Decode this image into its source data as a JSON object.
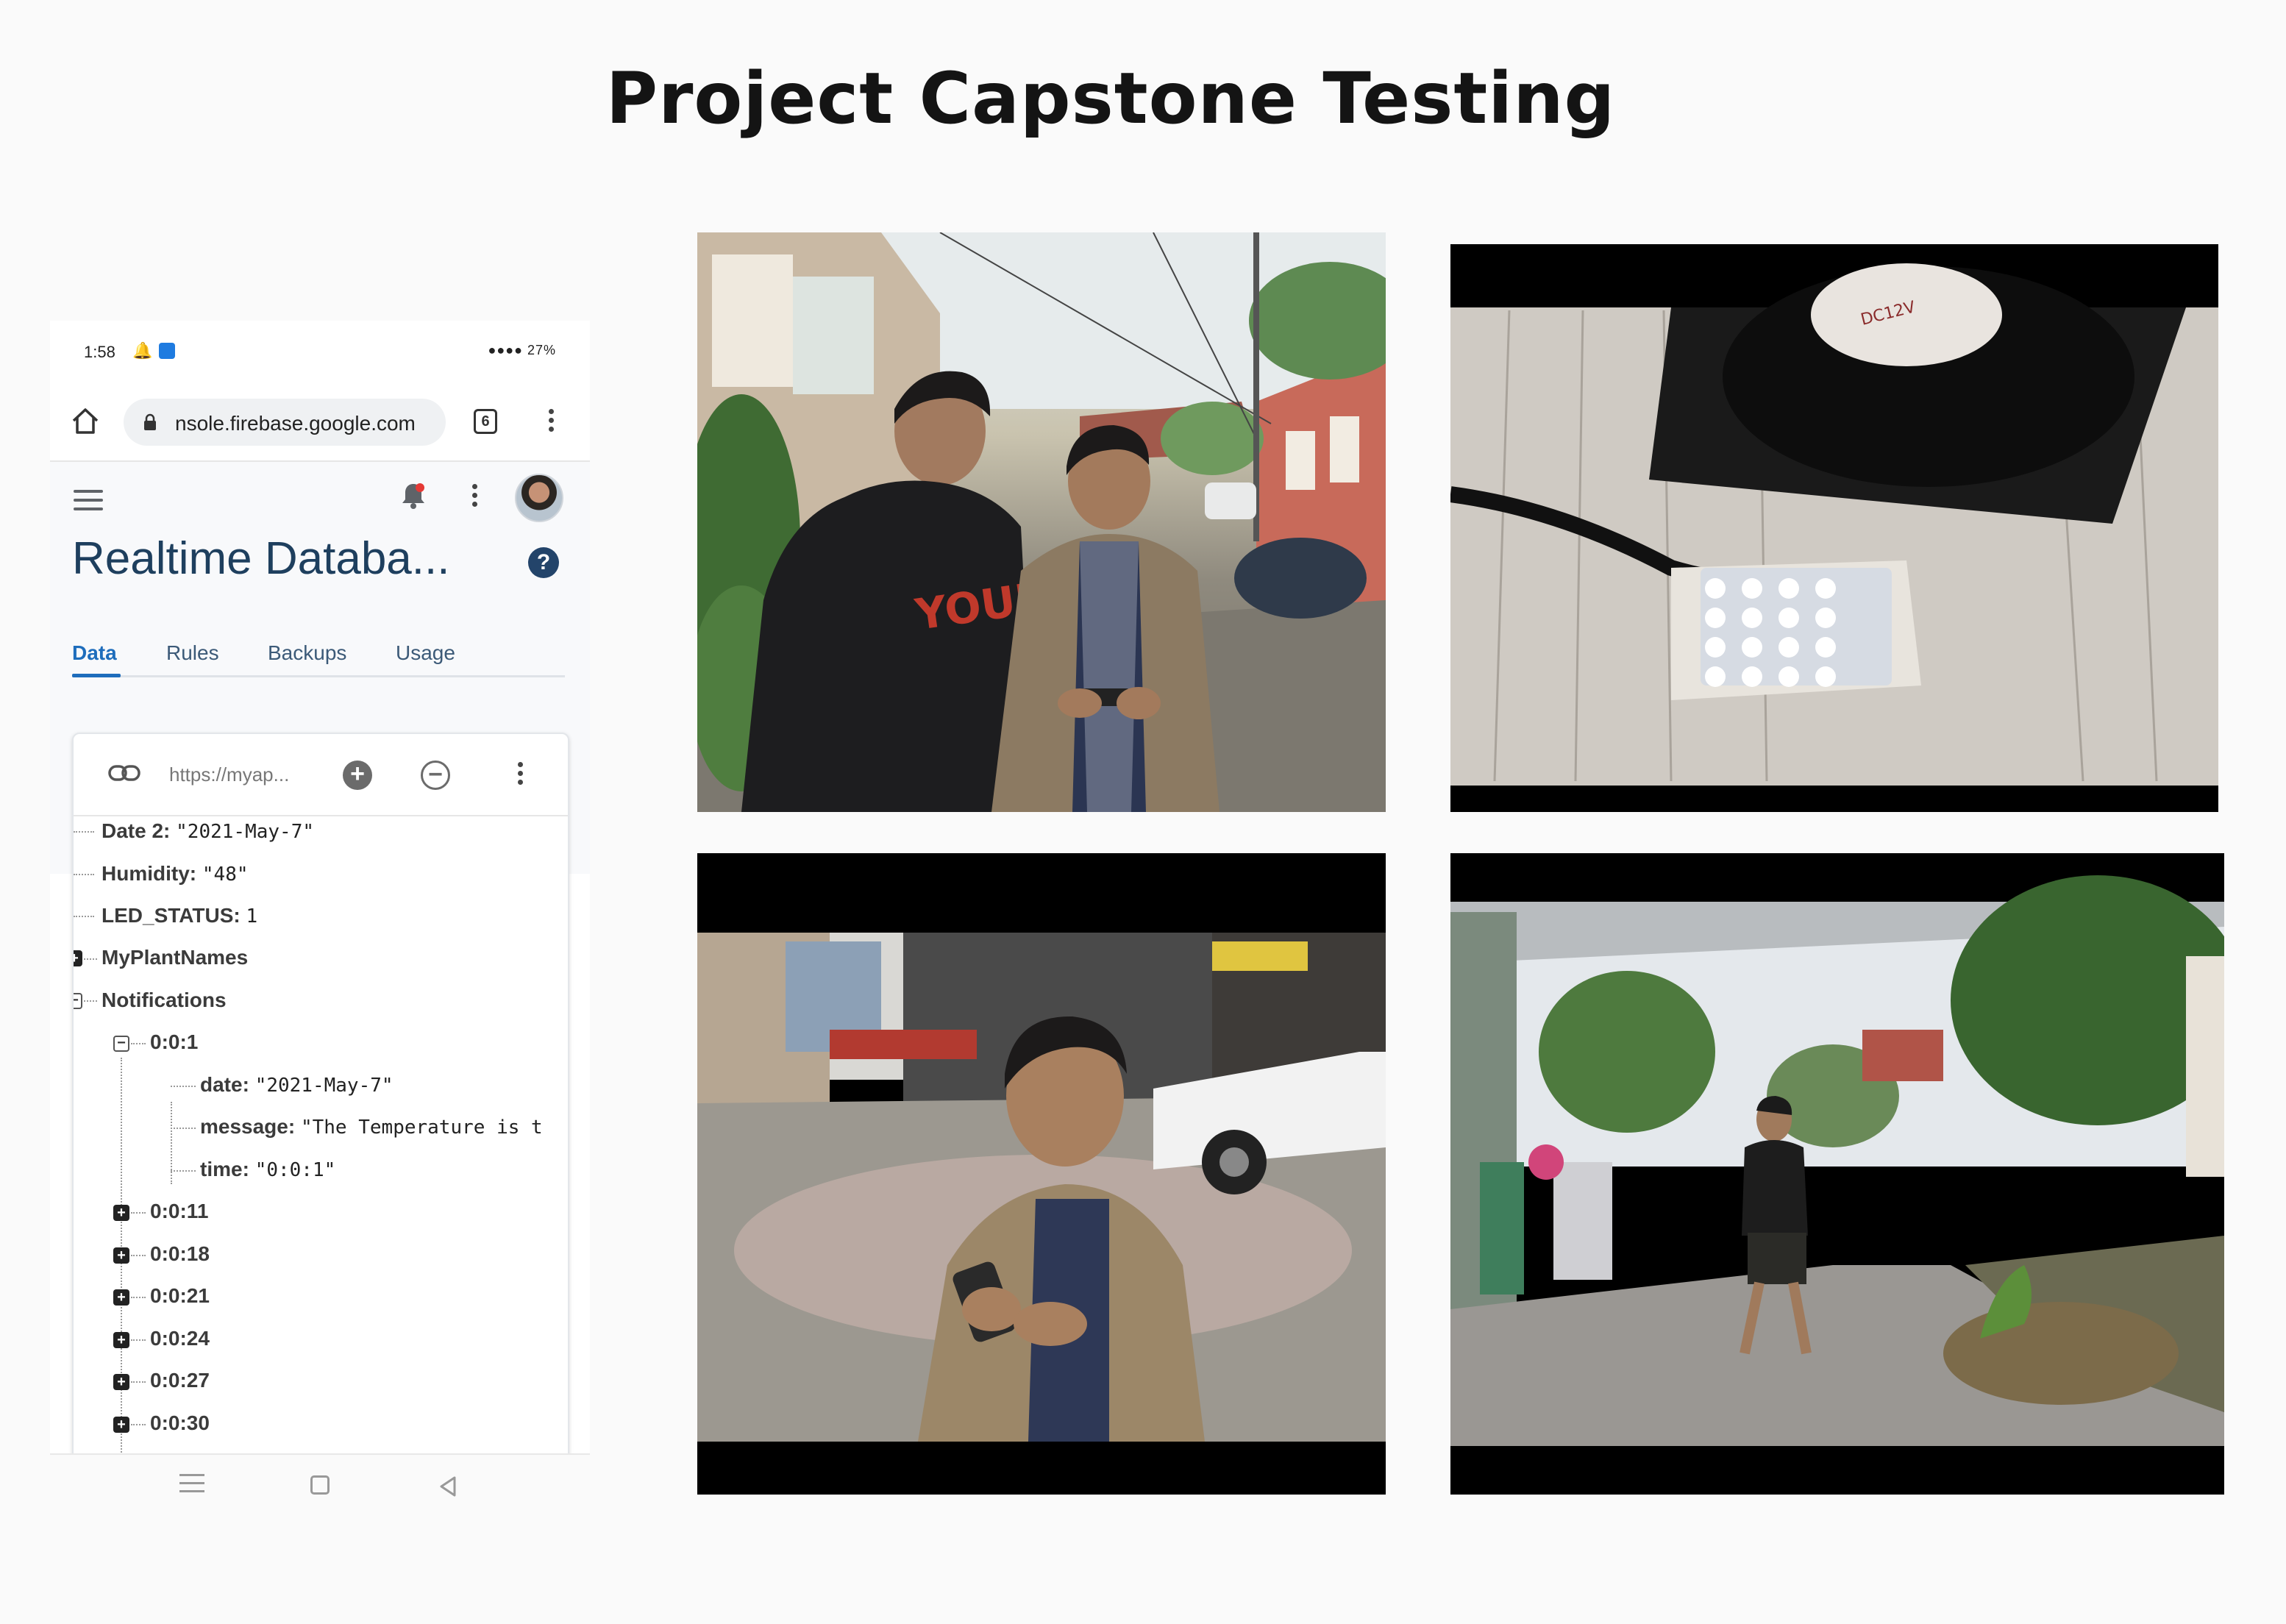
{
  "page": {
    "title": "Project Capstone Testing"
  },
  "phone": {
    "status": {
      "time": "1:58",
      "battery": "27%"
    },
    "browser": {
      "url": "nsole.firebase.google.com",
      "tab_count": "6"
    },
    "app": {
      "title": "Realtime Databa...",
      "tabs": [
        "Data",
        "Rules",
        "Backups",
        "Usage"
      ],
      "db_url": "https://myap..."
    },
    "tree": [
      {
        "key": "Date 2:",
        "value": "\"2021-May-7\""
      },
      {
        "key": "Humidity:",
        "value": "\"48\""
      },
      {
        "key": "LED_STATUS:",
        "value": "1"
      },
      {
        "key": "MyPlantNames",
        "value": ""
      },
      {
        "key": "Notifications",
        "value": ""
      },
      {
        "key": "0:0:1",
        "value": ""
      },
      {
        "key": "date:",
        "value": "\"2021-May-7\""
      },
      {
        "key": "message:",
        "value": "\"The Temperature is t"
      },
      {
        "key": "time:",
        "value": "\"0:0:1\""
      },
      {
        "key": "0:0:11",
        "value": ""
      },
      {
        "key": "0:0:18",
        "value": ""
      },
      {
        "key": "0:0:21",
        "value": ""
      },
      {
        "key": "0:0:24",
        "value": ""
      },
      {
        "key": "0:0:27",
        "value": ""
      },
      {
        "key": "0:0:30",
        "value": ""
      }
    ]
  },
  "photos": [
    {
      "name": "two-students-looking-at-phone"
    },
    {
      "name": "fan-and-led-panel-closeup"
    },
    {
      "name": "student-using-phone-in-street"
    },
    {
      "name": "student-walking-on-road"
    }
  ],
  "colors": {
    "firebase_title": "#1e3f5e",
    "tab_active": "#1e6dbc",
    "background": "#fafafa"
  }
}
